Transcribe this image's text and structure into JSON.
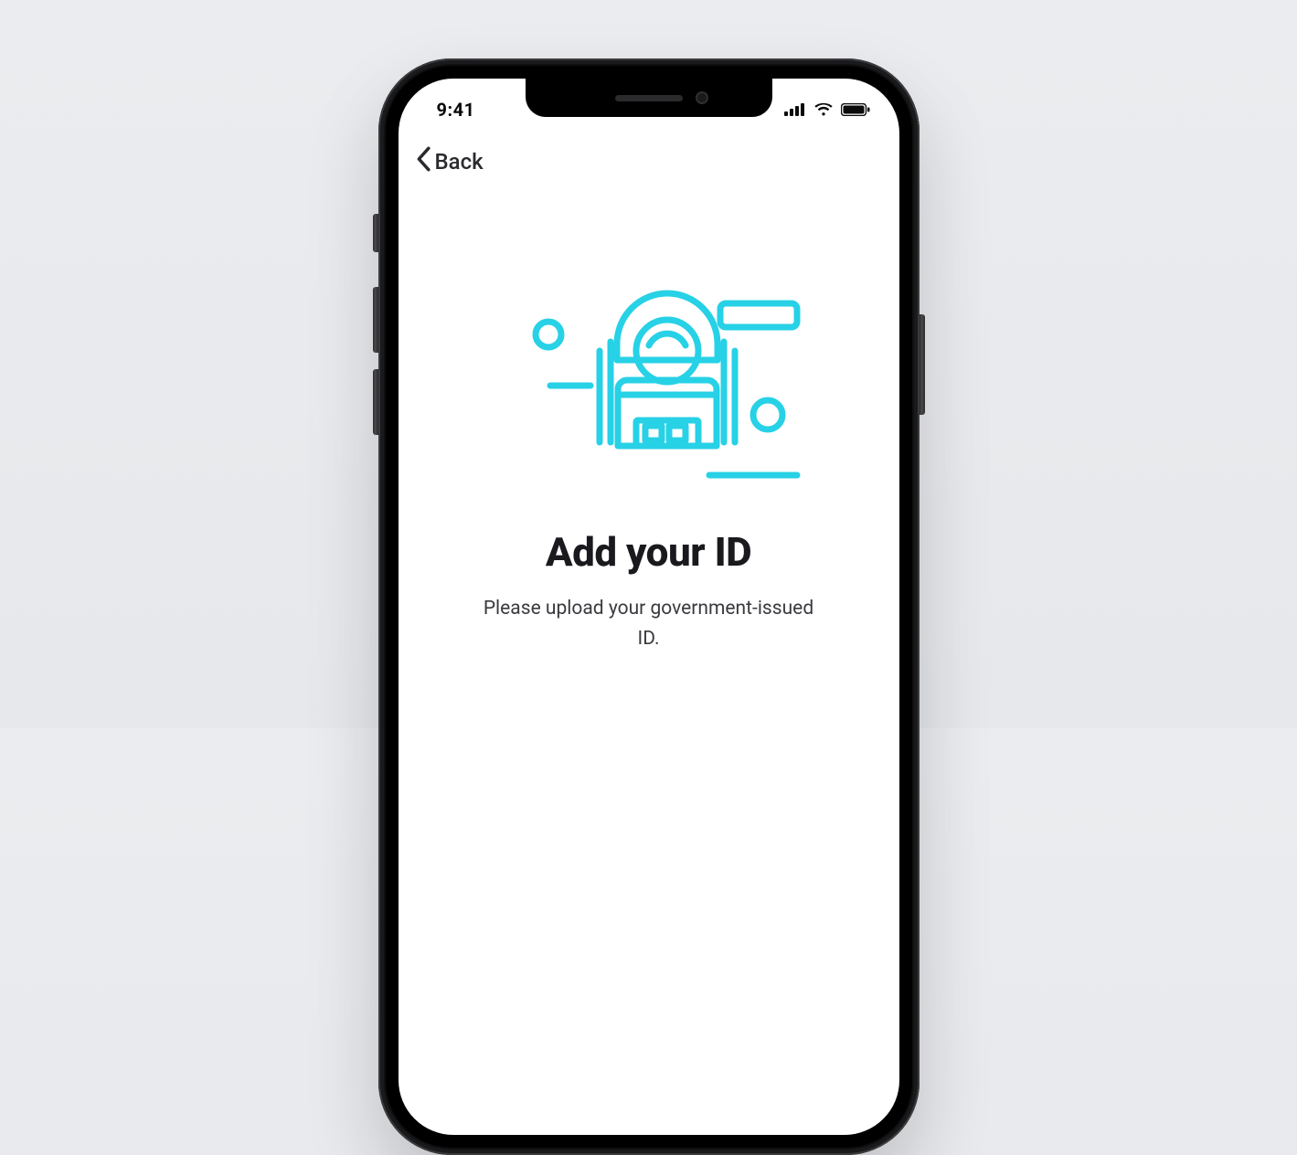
{
  "statusBar": {
    "time": "9:41"
  },
  "nav": {
    "backLabel": "Back"
  },
  "content": {
    "title": "Add your ID",
    "subtitle": "Please upload your government-issued ID."
  },
  "colors": {
    "accent": "#27d1e6"
  }
}
